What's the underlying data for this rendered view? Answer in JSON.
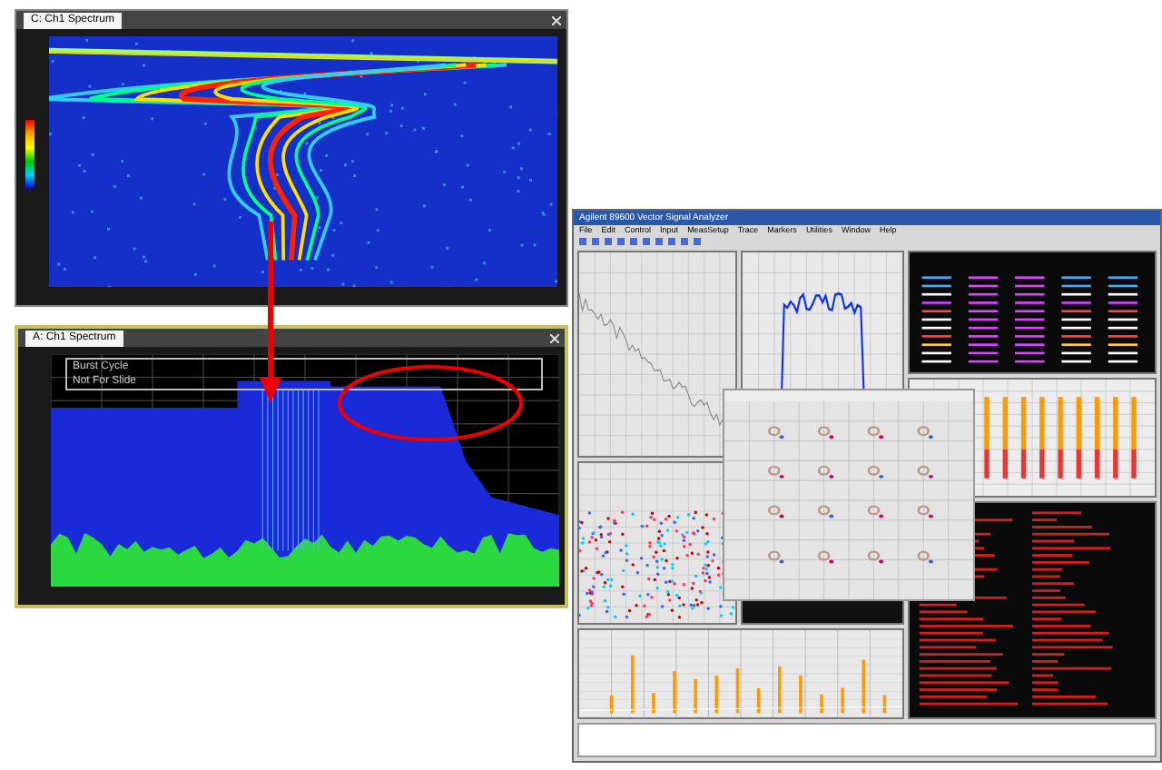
{
  "windows": [
    {
      "kind": "spectrogram",
      "tab": "C: Ch1 Spectrum"
    },
    {
      "kind": "spectrum",
      "tab": "A: Ch1 Spectrum",
      "legend": [
        "Burst Cycle",
        "Not For Slide"
      ]
    }
  ],
  "analyzer": {
    "title": "Agilent 89600 Vector Signal Analyzer",
    "menu": [
      "File",
      "Edit",
      "Control",
      "Input",
      "MeasSetup",
      "Trace",
      "Markers",
      "Utilities",
      "Window",
      "Help"
    ]
  }
}
